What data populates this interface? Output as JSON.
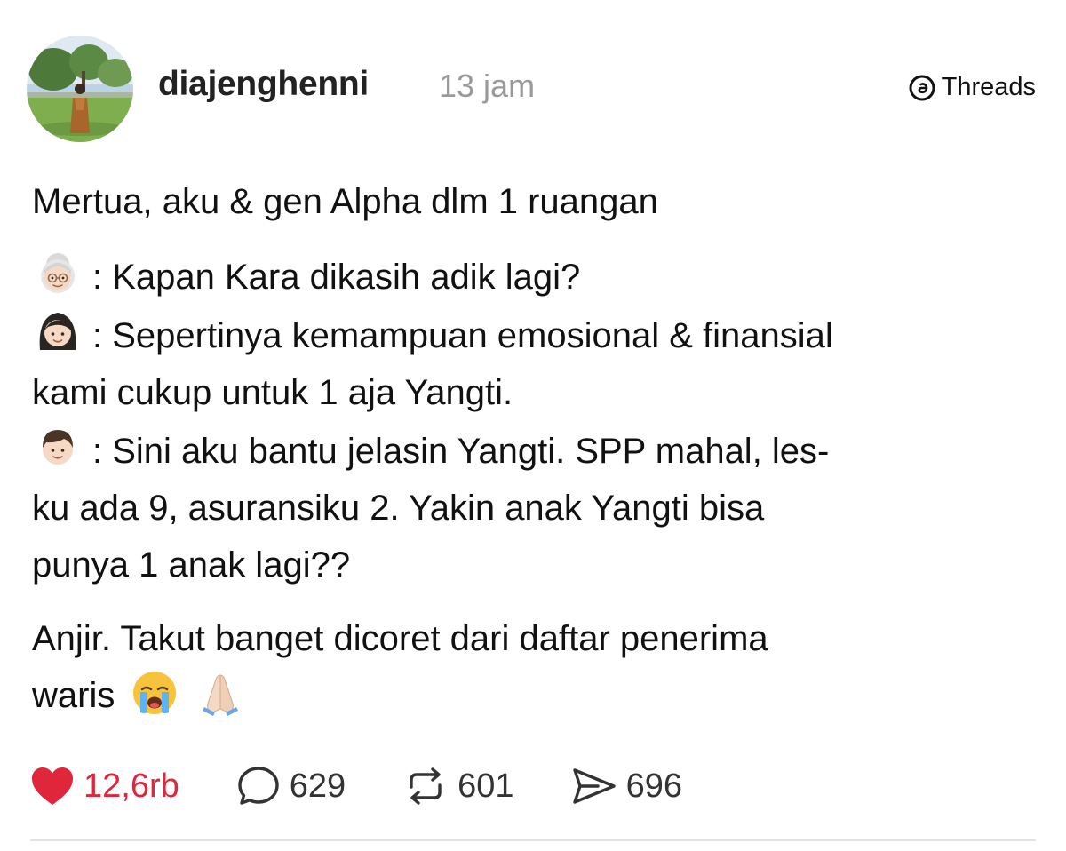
{
  "post": {
    "username": "diajenghenni",
    "time": "13 jam",
    "platform": "Threads",
    "intro": "Mertua, aku & gen Alpha dlm 1 ruangan",
    "dialogue": [
      {
        "speaker_icon": "old-woman-emoji",
        "text": ": Kapan Kara dikasih adik lagi?"
      },
      {
        "speaker_icon": "woman-emoji",
        "line1": ": Sepertinya kemampuan emosional & finansial",
        "line2": "kami cukup untuk 1 aja Yangti."
      },
      {
        "speaker_icon": "boy-emoji",
        "line1": ": Sini aku bantu jelasin Yangti. SPP mahal, les-",
        "line2": "ku ada 9, asuransiku 2. Yakin anak Yangti bisa",
        "line3": "punya 1 anak lagi??"
      }
    ],
    "closing_line1": "Anjir. Takut banget dicoret dari daftar penerima",
    "closing_line2": "waris",
    "closing_emojis": [
      "loudly-crying-face-emoji",
      "folded-hands-emoji"
    ]
  },
  "actions": {
    "likes": "12,6rb",
    "replies": "629",
    "reposts": "601",
    "shares": "696"
  },
  "colors": {
    "like": "#e0263a",
    "timestamp": "#9a9a9a",
    "text": "#111111"
  }
}
